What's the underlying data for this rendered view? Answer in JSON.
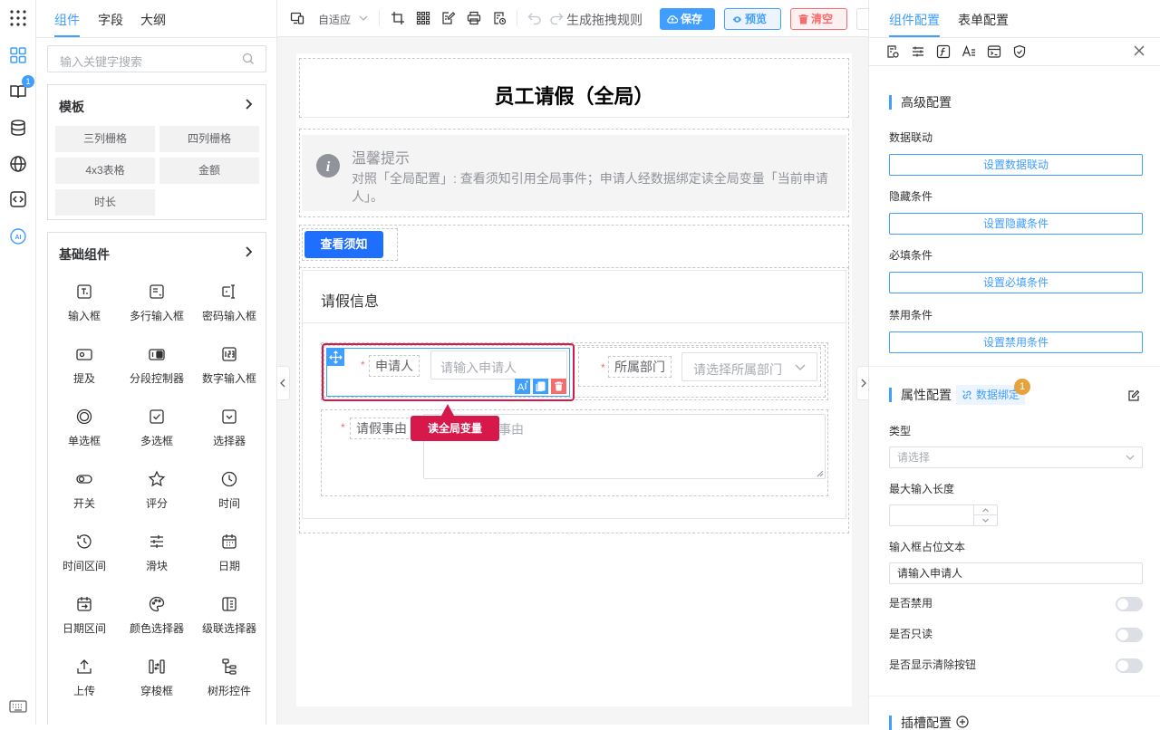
{
  "left": {
    "tabs": [
      "组件",
      "字段",
      "大纲"
    ],
    "search_placeholder": "输入关键字搜索",
    "template_title": "模板",
    "templates": [
      "三列栅格",
      "四列栅格",
      "4x3表格",
      "金额",
      "时长"
    ],
    "basic_title": "基础组件",
    "components": [
      "输入框",
      "多行输入框",
      "密码输入框",
      "提及",
      "分段控制器",
      "数字输入框",
      "单选框",
      "多选框",
      "选择器",
      "开关",
      "评分",
      "时间",
      "时间区间",
      "滑块",
      "日期",
      "日期区间",
      "颜色选择器",
      "级联选择器",
      "上传",
      "穿梭框",
      "树形控件"
    ]
  },
  "rail": {
    "badge": "1"
  },
  "toolbar": {
    "device": "自适应",
    "gen_rule": "生成拖拽规则",
    "save": "保存",
    "preview": "预览",
    "clear": "清空",
    "colors": {
      "save_bg": "#409eff",
      "preview_bg": "#ecf5ff",
      "clear_bg": "#fef0f0"
    }
  },
  "form": {
    "title": "员工请假（全局）",
    "tip_title": "温馨提示",
    "tip_text": "对照「全局配置」: 查看须知引用全局事件；申请人经数据绑定读全局变量「当前申请人」。",
    "notice_button": "查看须知",
    "card_title": "请假信息",
    "applicant_label": "申请人",
    "applicant_placeholder": "请输入申请人",
    "dept_label": "所属部门",
    "dept_placeholder": "请选择所属部门",
    "reason_label": "请假事由",
    "reason_placeholder": "请输入请假事由",
    "callout": "读全局变量",
    "required_mark": "*"
  },
  "right": {
    "tabs": [
      "组件配置",
      "表单配置"
    ],
    "advanced_title": "高级配置",
    "data_link_label": "数据联动",
    "data_link_btn": "设置数据联动",
    "hide_label": "隐藏条件",
    "hide_btn": "设置隐藏条件",
    "required_label": "必填条件",
    "required_btn": "设置必填条件",
    "disable_label": "禁用条件",
    "disable_btn": "设置禁用条件",
    "prop_title": "属性配置",
    "binding_tag": "数据绑定",
    "binding_badge": "1",
    "type_label": "类型",
    "type_placeholder": "请选择",
    "maxlen_label": "最大输入长度",
    "placeholder_label": "输入框占位文本",
    "placeholder_value": "请输入申请人",
    "disabled_label": "是否禁用",
    "readonly_label": "是否只读",
    "clearable_label": "是否显示清除按钮",
    "slot_title": "插槽配置"
  },
  "colors": {
    "primary": "#409eff",
    "highlight": "#d6184b",
    "danger": "#f56c6c",
    "badge_orange": "#e6a23c"
  }
}
